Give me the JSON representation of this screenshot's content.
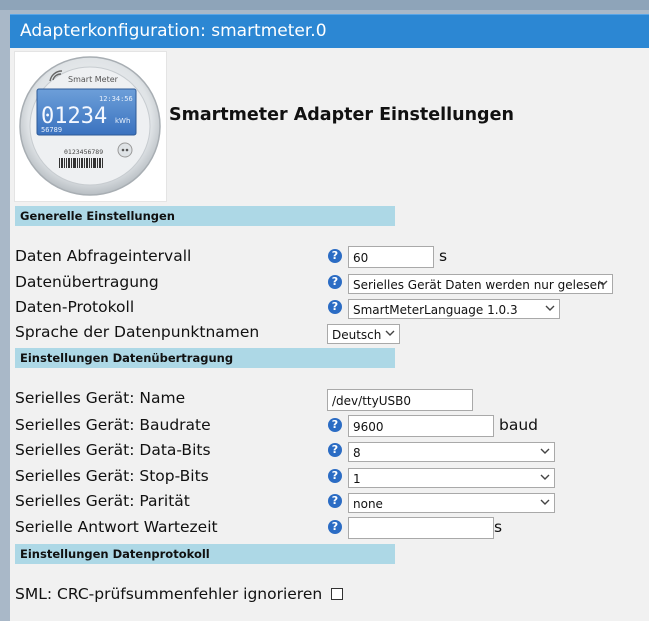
{
  "title": "Adapterkonfiguration: smartmeter.0",
  "heading": "Smartmeter Adapter Einstellungen",
  "logo": {
    "brand": "Smart Meter",
    "time": "12:34:56",
    "reading": "01234",
    "unit": "kWh",
    "meter_id": "56789",
    "serial": "0123456789"
  },
  "sections": {
    "general": "Generelle Einstellungen",
    "transmission": "Einstellungen Datenübertragung",
    "protocol": "Einstellungen Datenprotokoll"
  },
  "help_glyph": "?",
  "fields": {
    "interval": {
      "label": "Daten Abfrageintervall",
      "value": "60",
      "unit": "s"
    },
    "transfer": {
      "label": "Datenübertragung",
      "value": "Serielles Gerät Daten werden nur gelesen"
    },
    "protocol": {
      "label": "Daten-Protokoll",
      "value": "SmartMeterLanguage 1.0.3"
    },
    "language": {
      "label": "Sprache der Datenpunktnamen",
      "value": "Deutsch"
    },
    "device_name": {
      "label": "Serielles Gerät: Name",
      "value": "/dev/ttyUSB0"
    },
    "baudrate": {
      "label": "Serielles Gerät: Baudrate",
      "value": "9600",
      "unit": "baud"
    },
    "databits": {
      "label": "Serielles Gerät: Data-Bits",
      "value": "8"
    },
    "stopbits": {
      "label": "Serielles Gerät: Stop-Bits",
      "value": "1"
    },
    "parity": {
      "label": "Serielles Gerät: Parität",
      "value": "none"
    },
    "response_wait": {
      "label": "Serielle Antwort Wartezeit",
      "value": "",
      "unit": "s"
    },
    "crc_ignore": {
      "label": "SML: CRC-prüfsummenfehler ignorieren",
      "checked": false
    }
  },
  "colors": {
    "titlebar": "#2c87d3",
    "section": "#add8e6",
    "help": "#2b6cc4",
    "background": "#f1f1f1"
  }
}
